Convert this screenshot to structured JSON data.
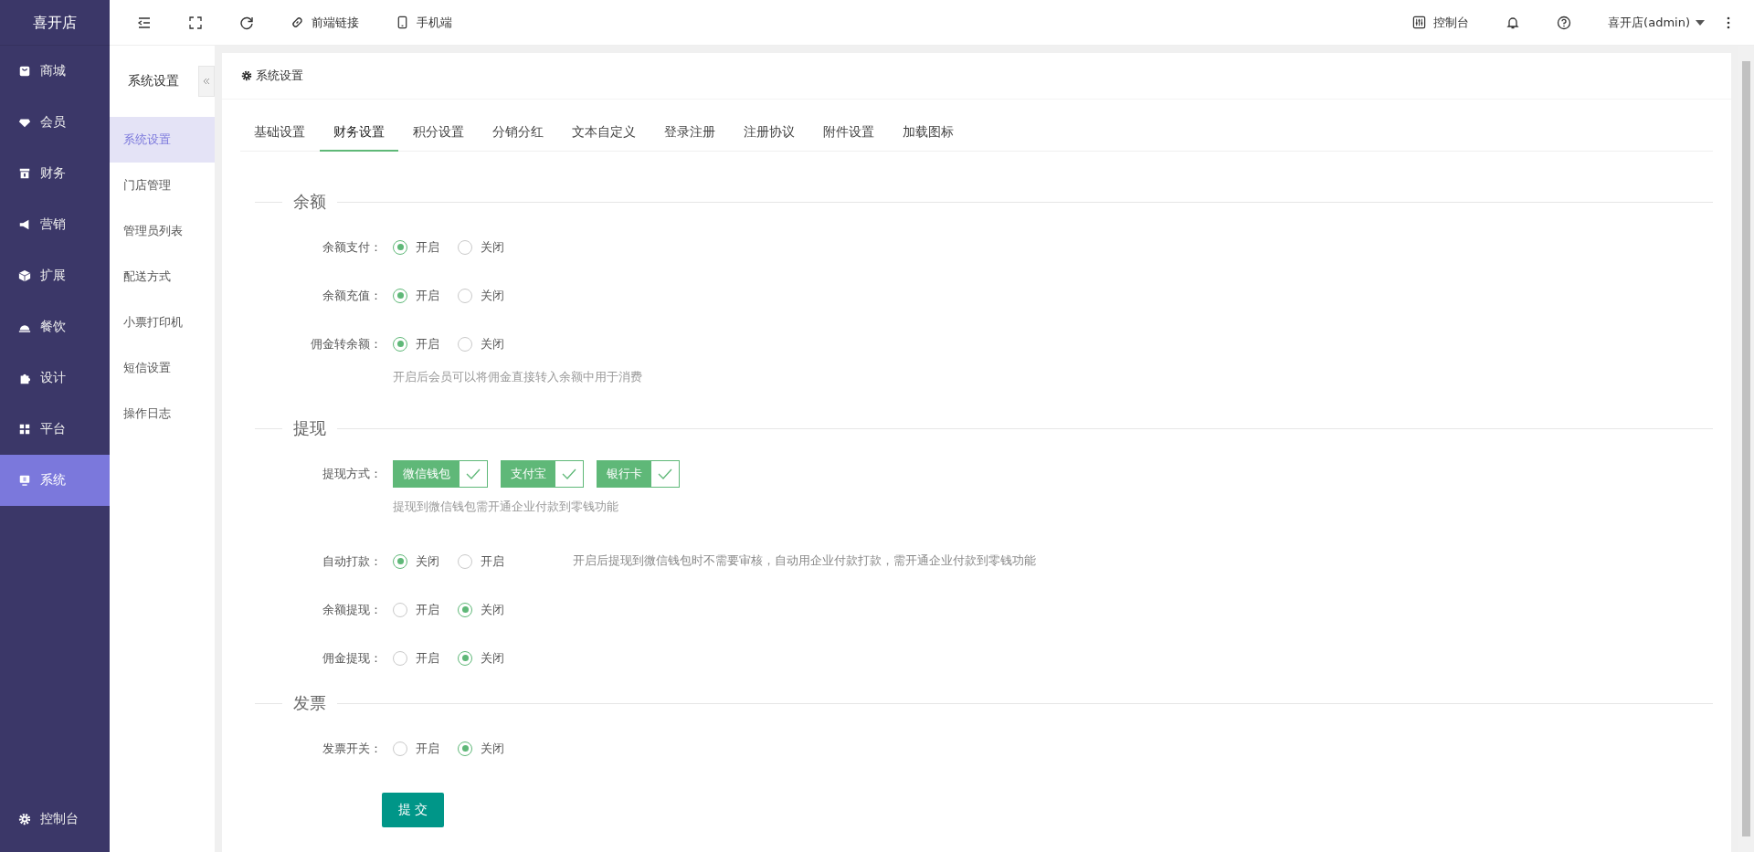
{
  "brand": "喜开店",
  "nav": [
    {
      "label": "商城",
      "selected": false
    },
    {
      "label": "会员",
      "selected": false
    },
    {
      "label": "财务",
      "selected": false
    },
    {
      "label": "营销",
      "selected": false
    },
    {
      "label": "扩展",
      "selected": false
    },
    {
      "label": "餐饮",
      "selected": false
    },
    {
      "label": "设计",
      "selected": false
    },
    {
      "label": "平台",
      "selected": false
    },
    {
      "label": "系统",
      "selected": true
    }
  ],
  "nav_footer": "控制台",
  "toolbar": {
    "links": [
      "前端链接",
      "手机端"
    ],
    "console": "控制台",
    "user": "喜开店(admin)"
  },
  "submenu": {
    "title": "系统设置",
    "items": [
      {
        "label": "系统设置",
        "selected": true
      },
      {
        "label": "门店管理",
        "selected": false
      },
      {
        "label": "管理员列表",
        "selected": false
      },
      {
        "label": "配送方式",
        "selected": false
      },
      {
        "label": "小票打印机",
        "selected": false
      },
      {
        "label": "短信设置",
        "selected": false
      },
      {
        "label": "操作日志",
        "selected": false
      }
    ]
  },
  "card_title": "系统设置",
  "tabs": [
    {
      "label": "基础设置",
      "selected": false
    },
    {
      "label": "财务设置",
      "selected": true
    },
    {
      "label": "积分设置",
      "selected": false
    },
    {
      "label": "分销分红",
      "selected": false
    },
    {
      "label": "文本自定义",
      "selected": false
    },
    {
      "label": "登录注册",
      "selected": false
    },
    {
      "label": "注册协议",
      "selected": false
    },
    {
      "label": "附件设置",
      "selected": false
    },
    {
      "label": "加载图标",
      "selected": false
    }
  ],
  "sections": [
    {
      "title": "余额",
      "rows": [
        {
          "kind": "radio",
          "label": "余额支付：",
          "options": [
            {
              "label": "开启",
              "selected": true
            },
            {
              "label": "关闭",
              "selected": false
            }
          ]
        },
        {
          "kind": "radio",
          "label": "余额充值：",
          "options": [
            {
              "label": "开启",
              "selected": true
            },
            {
              "label": "关闭",
              "selected": false
            }
          ]
        },
        {
          "kind": "radio",
          "label": "佣金转余额：",
          "options": [
            {
              "label": "开启",
              "selected": true
            },
            {
              "label": "关闭",
              "selected": false
            }
          ],
          "hint": "开启后会员可以将佣金直接转入余额中用于消费"
        }
      ]
    },
    {
      "title": "提现",
      "rows": [
        {
          "kind": "checks",
          "label": "提现方式：",
          "options": [
            {
              "label": "微信钱包",
              "checked": true
            },
            {
              "label": "支付宝",
              "checked": true
            },
            {
              "label": "银行卡",
              "checked": true
            }
          ],
          "hint": "提现到微信钱包需开通企业付款到零钱功能"
        },
        {
          "kind": "radio",
          "label": "自动打款：",
          "options": [
            {
              "label": "关闭",
              "selected": true
            },
            {
              "label": "开启",
              "selected": false
            }
          ],
          "side_hint": "开启后提现到微信钱包时不需要审核，自动用企业付款打款，需开通企业付款到零钱功能"
        },
        {
          "kind": "radio",
          "label": "余额提现：",
          "options": [
            {
              "label": "开启",
              "selected": false
            },
            {
              "label": "关闭",
              "selected": true
            }
          ]
        },
        {
          "kind": "radio",
          "label": "佣金提现：",
          "options": [
            {
              "label": "开启",
              "selected": false
            },
            {
              "label": "关闭",
              "selected": true
            }
          ]
        }
      ]
    },
    {
      "title": "发票",
      "rows": [
        {
          "kind": "radio",
          "label": "发票开关：",
          "options": [
            {
              "label": "开启",
              "selected": false
            },
            {
              "label": "关闭",
              "selected": true
            }
          ]
        }
      ]
    }
  ],
  "submit": "提 交"
}
